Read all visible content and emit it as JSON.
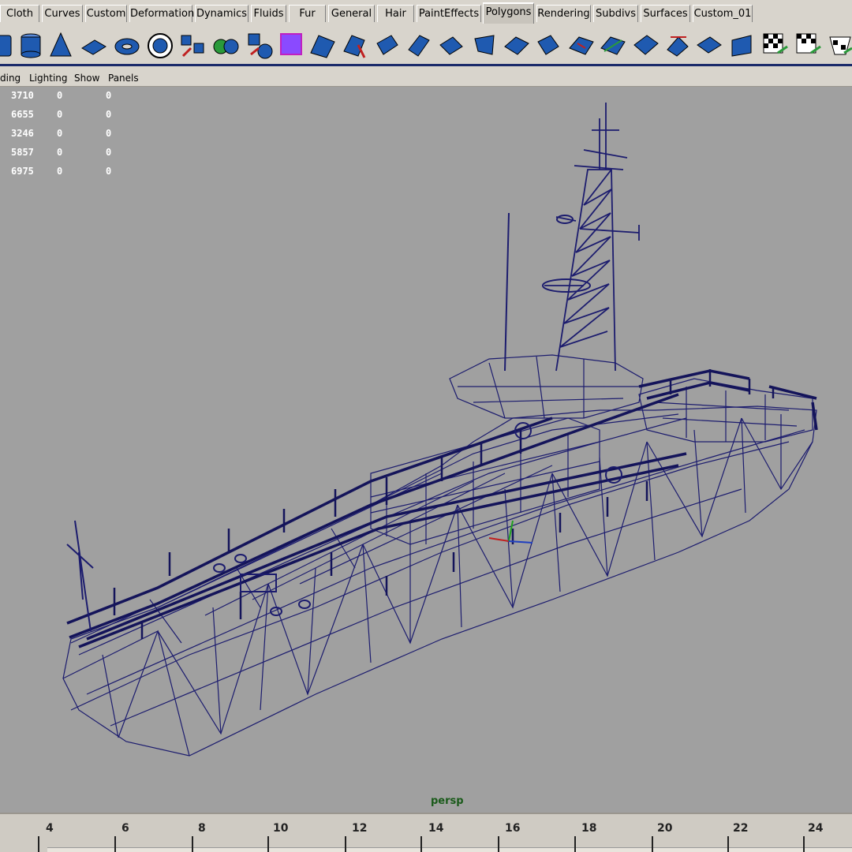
{
  "shelf_tabs": [
    {
      "label": "Cloth",
      "active": false
    },
    {
      "label": "Curves",
      "active": false
    },
    {
      "label": "Custom",
      "active": false
    },
    {
      "label": "Deformation",
      "active": false
    },
    {
      "label": "Dynamics",
      "active": false
    },
    {
      "label": "Fluids",
      "active": false
    },
    {
      "label": "Fur",
      "active": false
    },
    {
      "label": "General",
      "active": false
    },
    {
      "label": "Hair",
      "active": false
    },
    {
      "label": "PaintEffects",
      "active": false
    },
    {
      "label": "Polygons",
      "active": true
    },
    {
      "label": "Rendering",
      "active": false
    },
    {
      "label": "Subdivs",
      "active": false
    },
    {
      "label": "Surfaces",
      "active": false
    },
    {
      "label": "Custom_01",
      "active": false
    }
  ],
  "shelf_tools": [
    "poly-cube-icon",
    "poly-cylinder-icon",
    "poly-cone-icon",
    "poly-plane-icon",
    "poly-torus-icon",
    "poly-pipe-icon",
    "combine-icon",
    "separate-icon",
    "smooth-icon",
    "cut-faces-icon",
    "split-polygon-icon",
    "extrude-face-icon",
    "extrude-edge-icon",
    "bevel-icon",
    "merge-vertices-icon",
    "append-polygon-icon",
    "create-polygon-icon",
    "wedge-face-icon",
    "collapse-icon",
    "delete-edge-icon",
    "subdivide-icon",
    "triangulate-icon",
    "quadrangulate-icon",
    "reverse-normals-icon",
    "planar-mapping-icon",
    "cylindrical-mapping-icon",
    "spherical-mapping-icon",
    "automatic-mapping-icon"
  ],
  "panel_menu": [
    "ding",
    "Lighting",
    "Show",
    "Panels"
  ],
  "hud_stats": [
    [
      "3710",
      "0",
      "0"
    ],
    [
      "6655",
      "0",
      "0"
    ],
    [
      "3246",
      "0",
      "0"
    ],
    [
      "5857",
      "0",
      "0"
    ],
    [
      "6975",
      "0",
      "0"
    ]
  ],
  "camera_label": "persp",
  "timeline": {
    "ticks": [
      "4",
      "6",
      "8",
      "10",
      "12",
      "14",
      "16",
      "18",
      "20",
      "22",
      "24"
    ]
  },
  "colors": {
    "wireframe": "#1c1c6e",
    "viewport_bg": "#a0a0a0",
    "ui_bg": "#d8d4cc",
    "icon_blue": "#1f5ab0"
  }
}
